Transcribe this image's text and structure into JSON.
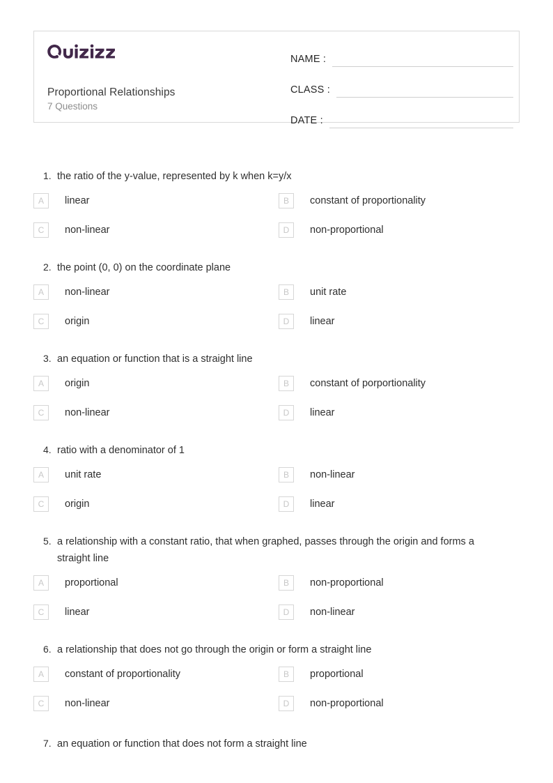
{
  "header": {
    "brand": "Quizizz",
    "brand_color": "#42284a",
    "title": "Proportional Relationships",
    "subtitle": "7 Questions",
    "fields": [
      {
        "label": "NAME :",
        "value": ""
      },
      {
        "label": "CLASS :",
        "value": ""
      },
      {
        "label": "DATE  :",
        "value": ""
      }
    ]
  },
  "questions": [
    {
      "number": "1.",
      "text": "the ratio of the y-value, represented by k when k=y/x",
      "options": [
        {
          "letter": "A",
          "text": "linear"
        },
        {
          "letter": "B",
          "text": "constant of proportionality"
        },
        {
          "letter": "C",
          "text": "non-linear"
        },
        {
          "letter": "D",
          "text": "non-proportional"
        }
      ]
    },
    {
      "number": "2.",
      "text": "the point (0, 0) on the coordinate plane",
      "options": [
        {
          "letter": "A",
          "text": "non-linear"
        },
        {
          "letter": "B",
          "text": "unit rate"
        },
        {
          "letter": "C",
          "text": "origin"
        },
        {
          "letter": "D",
          "text": "linear"
        }
      ]
    },
    {
      "number": "3.",
      "text": "an equation or function that is a straight line",
      "options": [
        {
          "letter": "A",
          "text": "origin"
        },
        {
          "letter": "B",
          "text": "constant of porportionality"
        },
        {
          "letter": "C",
          "text": "non-linear"
        },
        {
          "letter": "D",
          "text": "linear"
        }
      ]
    },
    {
      "number": "4.",
      "text": "ratio with a denominator of 1",
      "options": [
        {
          "letter": "A",
          "text": "unit rate"
        },
        {
          "letter": "B",
          "text": "non-linear"
        },
        {
          "letter": "C",
          "text": "origin"
        },
        {
          "letter": "D",
          "text": "linear"
        }
      ]
    },
    {
      "number": "5.",
      "text": "a relationship with a constant ratio, that when graphed, passes through the origin and forms a straight line",
      "options": [
        {
          "letter": "A",
          "text": "proportional"
        },
        {
          "letter": "B",
          "text": "non-proportional"
        },
        {
          "letter": "C",
          "text": "linear"
        },
        {
          "letter": "D",
          "text": "non-linear"
        }
      ]
    },
    {
      "number": "6.",
      "text": "a relationship that does not go through the origin or form a straight line",
      "options": [
        {
          "letter": "A",
          "text": "constant of proportionality"
        },
        {
          "letter": "B",
          "text": "proportional"
        },
        {
          "letter": "C",
          "text": "non-linear"
        },
        {
          "letter": "D",
          "text": "non-proportional"
        }
      ]
    },
    {
      "number": "7.",
      "text": "an equation or function that does not form a straight line",
      "options": []
    }
  ]
}
